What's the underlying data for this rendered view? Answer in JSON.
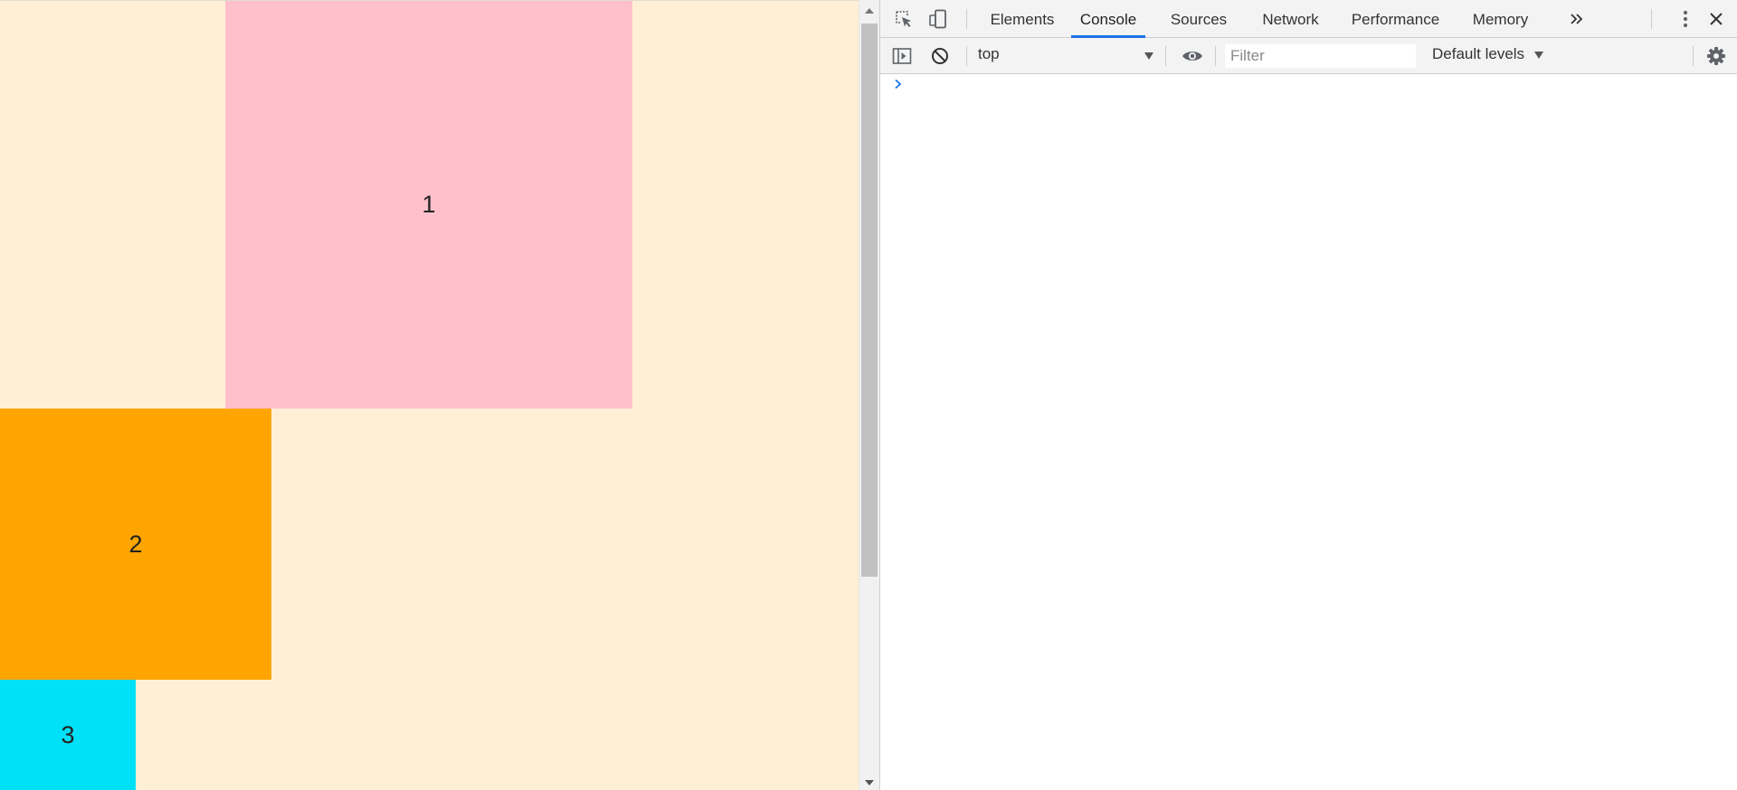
{
  "page": {
    "boxes": [
      {
        "label": "1",
        "color": "#ffc0cb"
      },
      {
        "label": "2",
        "color": "#ffa500"
      },
      {
        "label": "3",
        "color": "#00e1f8"
      }
    ],
    "background": "#fff0d5"
  },
  "devtools": {
    "tabs": {
      "elements": "Elements",
      "console": "Console",
      "sources": "Sources",
      "network": "Network",
      "performance": "Performance",
      "memory": "Memory"
    },
    "active_tab": "Console",
    "accent": "#1a73e8",
    "toolbar": {
      "context": "top",
      "filter_placeholder": "Filter",
      "levels": "Default levels"
    },
    "icons": {
      "inspect": "inspect-element-icon",
      "device": "device-toolbar-icon",
      "more_tabs": "more-tabs-icon",
      "menu": "kebab-menu-icon",
      "close": "close-icon",
      "sidebar": "console-sidebar-icon",
      "clear": "clear-console-icon",
      "eye": "live-expression-icon",
      "settings": "settings-gear-icon",
      "prompt": "console-prompt-icon"
    }
  }
}
